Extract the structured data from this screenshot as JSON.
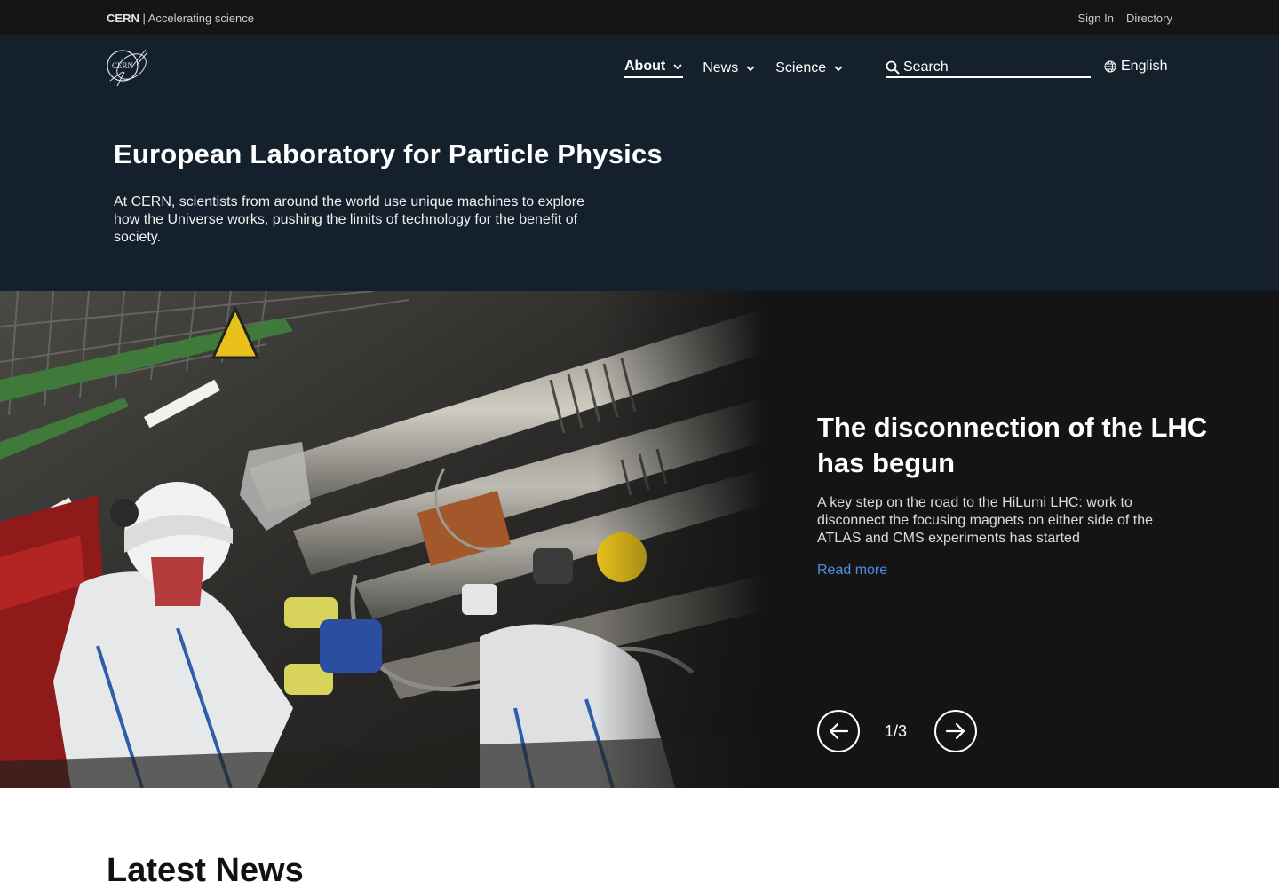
{
  "topbar": {
    "brand_strong": "CERN",
    "brand_rest": " | Accelerating science",
    "sign_in": "Sign In",
    "directory": "Directory"
  },
  "header": {
    "logo_text": "CERN",
    "nav": [
      {
        "label": "About",
        "active": true
      },
      {
        "label": "News",
        "active": false
      },
      {
        "label": "Science",
        "active": false
      }
    ],
    "search_placeholder": "Search",
    "language": "English"
  },
  "hero": {
    "title": "European Laboratory for Particle Physics",
    "description": "At CERN, scientists from around the world use unique machines to explore how the Universe works, pushing the limits of technology for the benefit of society."
  },
  "carousel": {
    "title": "The disconnection of the LHC has begun",
    "description": "A key step on the road to the HiLumi LHC: work to disconnect the focusing magnets on either side of the ATLAS and CMS experiments has started",
    "link": "Read more",
    "counter": "1/3",
    "prev_icon": "arrow-left-icon",
    "next_icon": "arrow-right-icon"
  },
  "latest": {
    "title": "Latest News"
  },
  "colors": {
    "topbar_bg": "#151515",
    "hero_bg": "#14202b",
    "carousel_bg": "#141414",
    "link": "#4f8fe6"
  }
}
